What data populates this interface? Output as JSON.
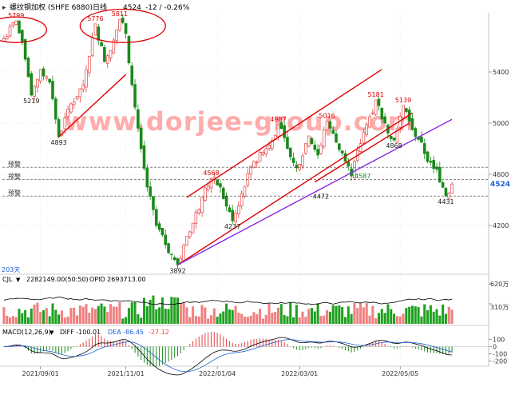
{
  "header": {
    "title": "螺纹钢加权 (SHFE 6880)",
    "period": "日线",
    "last": "4524",
    "change": "-12 / -0.26%"
  },
  "colors": {
    "up": "#e84040",
    "down": "#1a8a1a",
    "trend": "#dd0000",
    "channel": "#8a2be2",
    "dif": "#000000",
    "dea": "#1f5fd6",
    "price_box": "#1f5fd6",
    "vol_up": "#f08080",
    "vol_down": "#1fa01f"
  },
  "chart_data": [
    {
      "type": "candlestick",
      "panel": "price",
      "ylim": [
        3850,
        5850
      ],
      "yticks": [
        4200,
        4600,
        5000,
        5400
      ],
      "x_tick_labels": [
        "2021/09/01",
        "2021/11/01",
        "2022/01/04",
        "2022/03/01",
        "2022/05/05"
      ],
      "x_tick_index": [
        12,
        40,
        70,
        97,
        130
      ],
      "n_bars": 148,
      "anchors": [
        [
          0,
          5660
        ],
        [
          4,
          5799
        ],
        [
          7,
          5500
        ],
        [
          9,
          5219
        ],
        [
          12,
          5420
        ],
        [
          15,
          5320
        ],
        [
          18,
          4893
        ],
        [
          22,
          5150
        ],
        [
          26,
          5300
        ],
        [
          30,
          5776
        ],
        [
          33,
          5480
        ],
        [
          36,
          5650
        ],
        [
          38,
          5811
        ],
        [
          40,
          5700
        ],
        [
          42,
          5300
        ],
        [
          45,
          4800
        ],
        [
          47,
          4500
        ],
        [
          50,
          4200
        ],
        [
          53,
          4050
        ],
        [
          57,
          3892
        ],
        [
          61,
          4150
        ],
        [
          65,
          4420
        ],
        [
          68,
          4568
        ],
        [
          71,
          4500
        ],
        [
          73,
          4350
        ],
        [
          75,
          4237
        ],
        [
          78,
          4450
        ],
        [
          82,
          4700
        ],
        [
          86,
          4800
        ],
        [
          90,
          4987
        ],
        [
          93,
          4800
        ],
        [
          96,
          4650
        ],
        [
          100,
          4900
        ],
        [
          103,
          4750
        ],
        [
          106,
          5016
        ],
        [
          109,
          4850
        ],
        [
          112,
          4700
        ],
        [
          114,
          4587
        ],
        [
          117,
          4840
        ],
        [
          120,
          5050
        ],
        [
          122,
          5181
        ],
        [
          125,
          5000
        ],
        [
          128,
          4868
        ],
        [
          131,
          5139
        ],
        [
          134,
          4950
        ],
        [
          137,
          4850
        ],
        [
          139,
          4700
        ],
        [
          142,
          4640
        ],
        [
          145,
          4431
        ],
        [
          147,
          4524
        ]
      ],
      "last_price": 4524,
      "annotations": [
        {
          "label": "5799",
          "i": 4,
          "price": 5799,
          "pos": "above"
        },
        {
          "label": "5219",
          "i": 9,
          "price": 5219,
          "pos": "below"
        },
        {
          "label": "4893",
          "i": 18,
          "price": 4893,
          "pos": "below"
        },
        {
          "label": "5776",
          "i": 30,
          "price": 5776,
          "pos": "above"
        },
        {
          "label": "5811",
          "i": 38,
          "price": 5811,
          "pos": "above"
        },
        {
          "label": "3892",
          "i": 57,
          "price": 3892,
          "pos": "below"
        },
        {
          "label": "4568",
          "i": 68,
          "price": 4568,
          "pos": "above"
        },
        {
          "label": "4237",
          "i": 75,
          "price": 4237,
          "pos": "below"
        },
        {
          "label": "4987",
          "i": 90,
          "price": 4987,
          "pos": "above"
        },
        {
          "label": "4472",
          "i": 104,
          "price": 4472,
          "pos": "below"
        },
        {
          "label": "5016",
          "i": 106,
          "price": 5016,
          "pos": "above"
        },
        {
          "label": "4587",
          "i": 114,
          "price": 4587,
          "pos": "right"
        },
        {
          "label": "5181",
          "i": 122,
          "price": 5181,
          "pos": "above"
        },
        {
          "label": "4868",
          "i": 128,
          "price": 4868,
          "pos": "below"
        },
        {
          "label": "5139",
          "i": 131,
          "price": 5139,
          "pos": "above"
        },
        {
          "label": "4431",
          "i": 145,
          "price": 4431,
          "pos": "below"
        }
      ],
      "hlines": [
        {
          "price": 4655,
          "label": "预警"
        },
        {
          "price": 4560,
          "label": "预警"
        },
        {
          "price": 4430,
          "label": "预警"
        }
      ],
      "trendlines": [
        {
          "kind": "trend",
          "from": [
            18,
            4893
          ],
          "to": [
            40,
            5380
          ]
        },
        {
          "kind": "trend",
          "from": [
            57,
            3892
          ],
          "to": [
            134,
            5080
          ]
        },
        {
          "kind": "trend",
          "from": [
            60,
            4420
          ],
          "to": [
            124,
            5420
          ]
        },
        {
          "kind": "trend",
          "from": [
            102,
            4540
          ],
          "to": [
            133,
            5000
          ]
        },
        {
          "kind": "channel",
          "from": [
            57,
            3892
          ],
          "to": [
            147,
            5030
          ]
        }
      ],
      "ellipses": [
        {
          "center": [
            4,
            5730
          ],
          "rx_bars": 10,
          "ry_price": 100
        },
        {
          "center": [
            39,
            5760
          ],
          "rx_bars": 14,
          "ry_price": 130
        }
      ],
      "bottom_label": "203天"
    },
    {
      "type": "bar",
      "panel": "volume",
      "legend": "CJL",
      "values_label": "2282149.00(50:50)",
      "opid_label": "OPID 2693713.00",
      "yticks_labels": [
        "620万",
        "310万"
      ],
      "ylim": [
        0,
        620
      ],
      "ytick_values": [
        620,
        310
      ]
    },
    {
      "type": "macd",
      "panel": "macd",
      "legend": "MACD(12,26,9)",
      "diff_label": "DIFF -100.01",
      "dea_label": "DEA -86.45",
      "macd_label": "-27.12",
      "ylim": [
        -250,
        150
      ],
      "yticks": [
        100,
        0,
        -100,
        -200
      ],
      "yticks_labels": [
        "100",
        "0",
        "-100",
        "-200"
      ]
    }
  ],
  "watermark": "www.dorjee-group.com"
}
